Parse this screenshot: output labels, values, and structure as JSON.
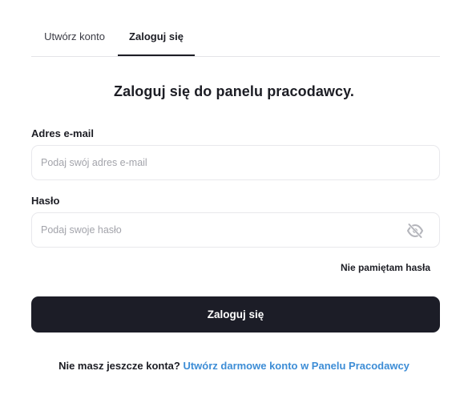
{
  "tabs": {
    "register_label": "Utwórz konto",
    "login_label": "Zaloguj się",
    "active": "login"
  },
  "heading": "Zaloguj się do panelu pracodawcy.",
  "email": {
    "label": "Adres e-mail",
    "placeholder": "Podaj swój adres e-mail",
    "value": ""
  },
  "password": {
    "label": "Hasło",
    "placeholder": "Podaj swoje hasło",
    "value": "",
    "toggle_icon": "eye-off-icon"
  },
  "forgot_label": "Nie pamiętam hasła",
  "submit_label": "Zaloguj się",
  "footer": {
    "prompt": "Nie masz jeszcze konta?",
    "link_label": "Utwórz darmowe konto w Panelu Pracodawcy"
  },
  "colors": {
    "primary": "#1c1d27",
    "link": "#3d8dd6",
    "border": "#e8e8ec",
    "placeholder": "#a3a4ab"
  }
}
